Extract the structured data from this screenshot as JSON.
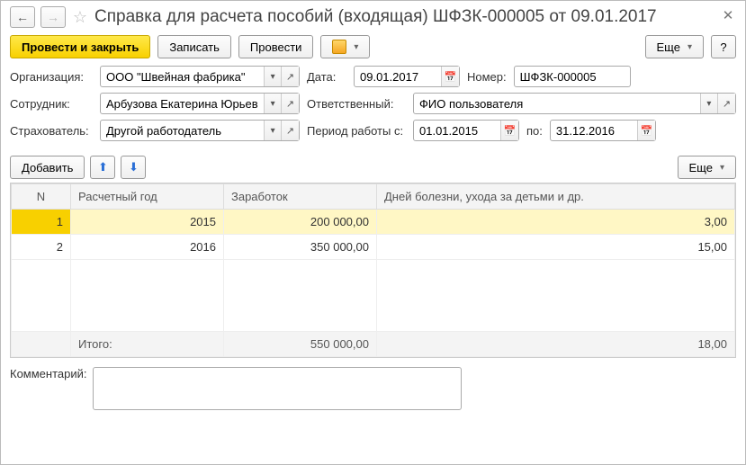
{
  "header": {
    "title": "Справка для расчета пособий (входящая) ШФЗК-000005 от 09.01.2017"
  },
  "toolbar": {
    "post_close": "Провести и закрыть",
    "save": "Записать",
    "post": "Провести",
    "more": "Еще",
    "help": "?"
  },
  "form": {
    "org_label": "Организация:",
    "org_value": "ООО \"Швейная фабрика\"",
    "date_label": "Дата:",
    "date_value": "09.01.2017",
    "num_label": "Номер:",
    "num_value": "ШФЗК-000005",
    "emp_label": "Сотрудник:",
    "emp_value": "Арбузова Екатерина Юрьевна",
    "resp_label": "Ответственный:",
    "resp_value": "ФИО пользователя",
    "ins_label": "Страхователь:",
    "ins_value": "Другой работодатель",
    "period_label": "Период работы с:",
    "period_from": "01.01.2015",
    "period_to_label": "по:",
    "period_to": "31.12.2016"
  },
  "tablebar": {
    "add": "Добавить",
    "more": "Еще"
  },
  "table": {
    "cols": {
      "n": "N",
      "year": "Расчетный год",
      "sum": "Заработок",
      "days": "Дней болезни, ухода за детьми и др."
    },
    "rows": [
      {
        "n": "1",
        "year": "2015",
        "sum": "200 000,00",
        "days": "3,00"
      },
      {
        "n": "2",
        "year": "2016",
        "sum": "350 000,00",
        "days": "15,00"
      }
    ],
    "footer": {
      "label": "Итого:",
      "sum": "550 000,00",
      "days": "18,00"
    }
  },
  "comment": {
    "label": "Комментарий:",
    "value": ""
  }
}
